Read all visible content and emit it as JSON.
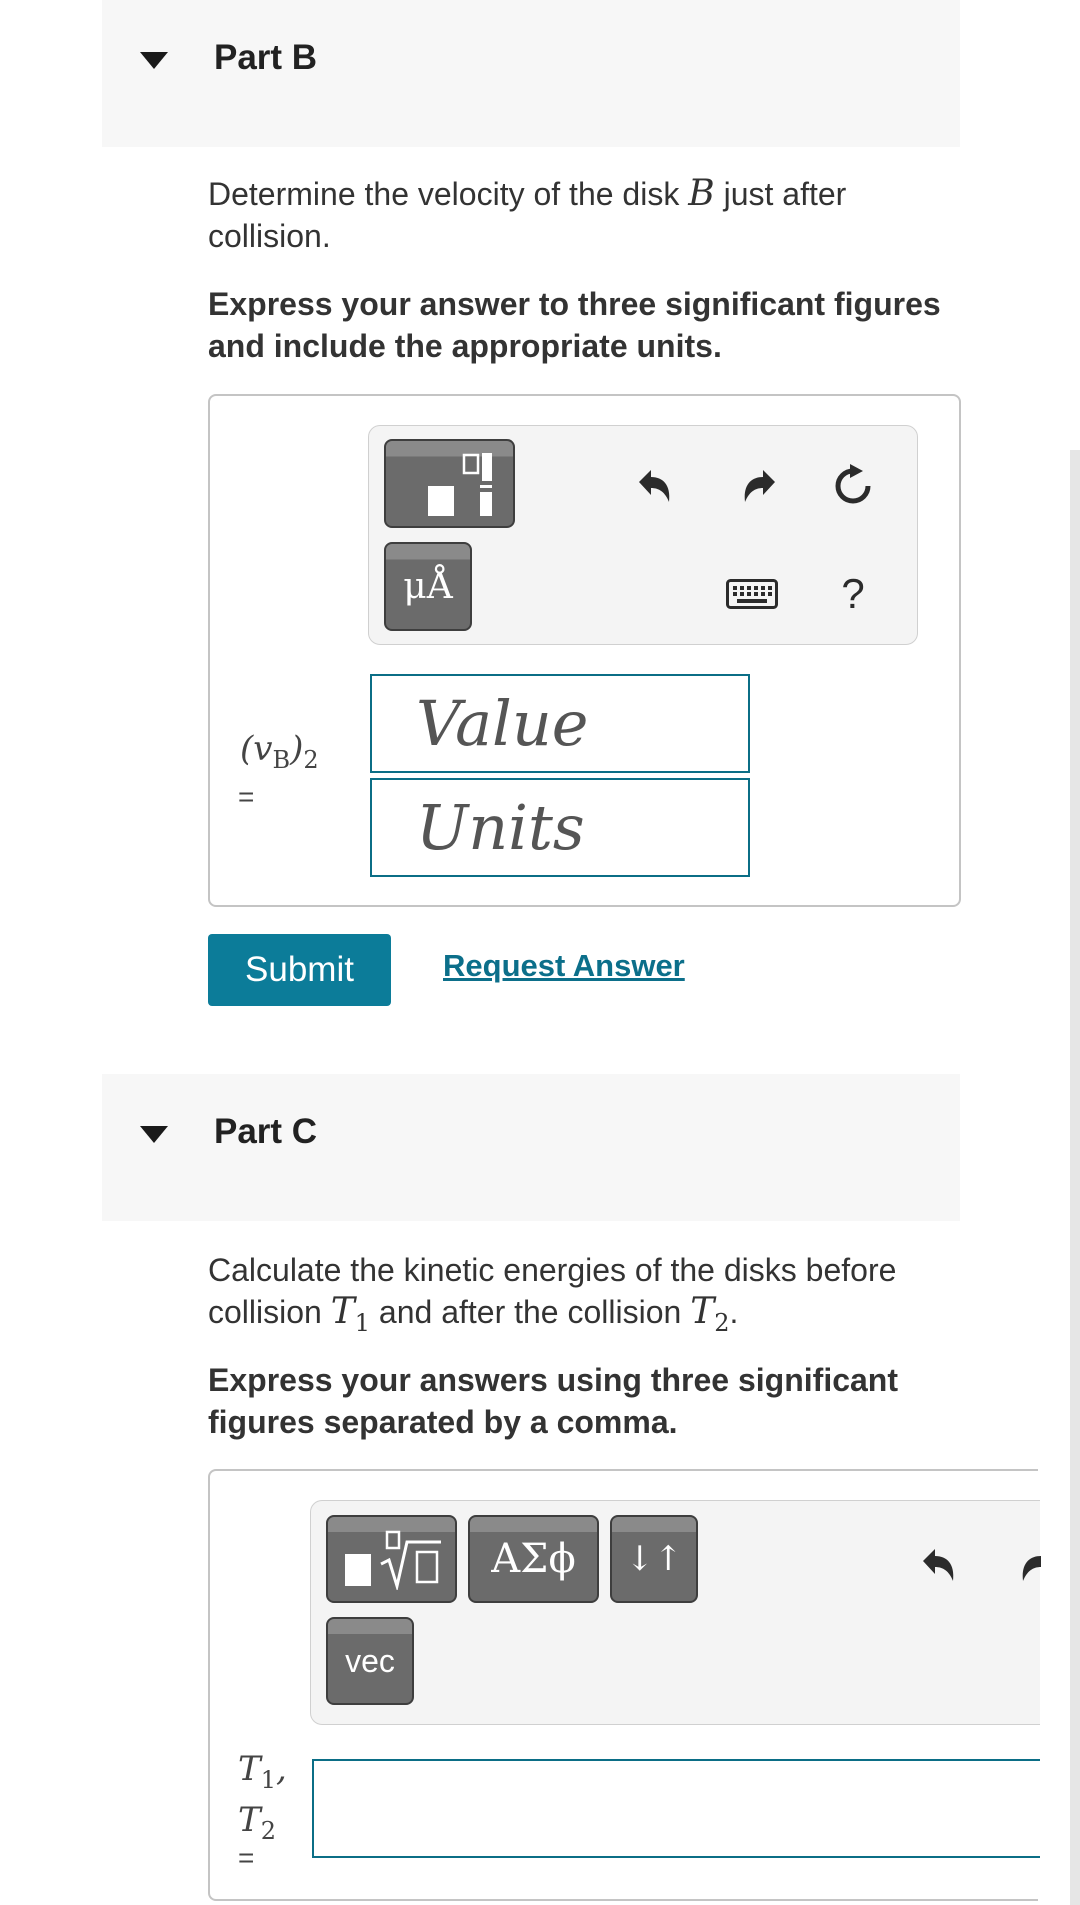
{
  "part_b": {
    "title": "Part B",
    "question_pre": "Determine the velocity of the disk ",
    "question_var": "B",
    "question_post": " just after collision.",
    "instruction": "Express your answer to three significant figures and include the appropriate units.",
    "toolbar": {
      "units_button": "μÅ",
      "help": "?"
    },
    "answer_label_base": "(v",
    "answer_label_sub": "B",
    "answer_label_close": ")",
    "answer_label_index": "2",
    "equals": "=",
    "value_placeholder": "Value",
    "units_placeholder": "Units",
    "submit_label": "Submit",
    "request_label": "Request Answer"
  },
  "part_c": {
    "title": "Part C",
    "question_pre": "Calculate the kinetic energies of the disks before collision ",
    "t1_base": "T",
    "t1_sub": "1",
    "question_mid": " and after the collision ",
    "t2_base": "T",
    "t2_sub": "2",
    "question_post": ".",
    "instruction": "Express your answers using three significant figures separated by a comma.",
    "toolbar": {
      "greek_button": "ΑΣϕ",
      "arrows_button": "↓↑",
      "vec_button": "vec"
    },
    "label_t1": "T",
    "label_t1_sub": "1",
    "label_comma": ",",
    "label_t2": "T",
    "label_t2_sub": "2",
    "equals": "="
  },
  "icons": [
    "caret-down-icon",
    "template-icon",
    "undo-icon",
    "redo-icon",
    "reset-icon",
    "keyboard-icon",
    "help-icon",
    "radical-template-icon"
  ],
  "colors": {
    "accent": "#0c7c99",
    "field_border": "#0b6e86",
    "header_bg": "#f7f7f7",
    "toolbar_btn": "#6b6b6b"
  }
}
